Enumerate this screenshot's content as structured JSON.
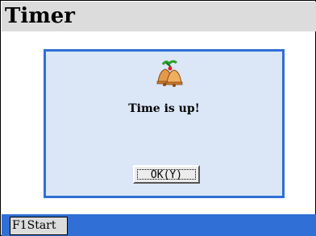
{
  "window": {
    "title": "Timer"
  },
  "dialog": {
    "icon": "bell-icon",
    "message": "Time is up!",
    "ok_label": "OK(Y)"
  },
  "taskbar": {
    "start_label": "F1Start"
  },
  "colors": {
    "accent": "#2f6fd6",
    "dialog_bg": "#dbe6f7",
    "titlebar_bg": "#dcdcdc"
  }
}
